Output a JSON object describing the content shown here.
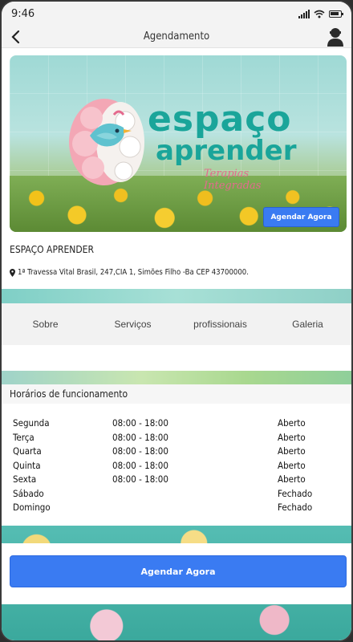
{
  "status_bar": {
    "time": "9:46"
  },
  "header": {
    "title": "Agendamento"
  },
  "banner": {
    "logo_line1": "espaço",
    "logo_line2": "aprender",
    "logo_tagline": "Terapias Integradas",
    "cta_label": "Agendar Agora"
  },
  "business": {
    "name": "ESPAÇO APRENDER",
    "address": "1ª Travessa Vital Brasil, 247,CIA 1, Simões Filho -Ba CEP 43700000."
  },
  "tabs": [
    {
      "label": "Sobre"
    },
    {
      "label": "Serviços"
    },
    {
      "label": "profissionais"
    },
    {
      "label": "Galeria"
    }
  ],
  "hours": {
    "title": "Horários de funcionamento",
    "rows": [
      {
        "day": "Segunda",
        "time": "08:00 - 18:00",
        "status": "Aberto"
      },
      {
        "day": "Terça",
        "time": "08:00 - 18:00",
        "status": "Aberto"
      },
      {
        "day": "Quarta",
        "time": "08:00 - 18:00",
        "status": "Aberto"
      },
      {
        "day": "Quinta",
        "time": "08:00 - 18:00",
        "status": "Aberto"
      },
      {
        "day": "Sexta",
        "time": "08:00 - 18:00",
        "status": "Aberto"
      },
      {
        "day": "Sábado",
        "time": "",
        "status": "Fechado"
      },
      {
        "day": "Domingo",
        "time": "",
        "status": "Fechado"
      }
    ]
  },
  "main_cta": {
    "label": "Agendar Agora"
  },
  "colors": {
    "accent": "#3a7bf2",
    "logo_teal": "#1aa59a",
    "logo_pink": "#e46a8e"
  }
}
